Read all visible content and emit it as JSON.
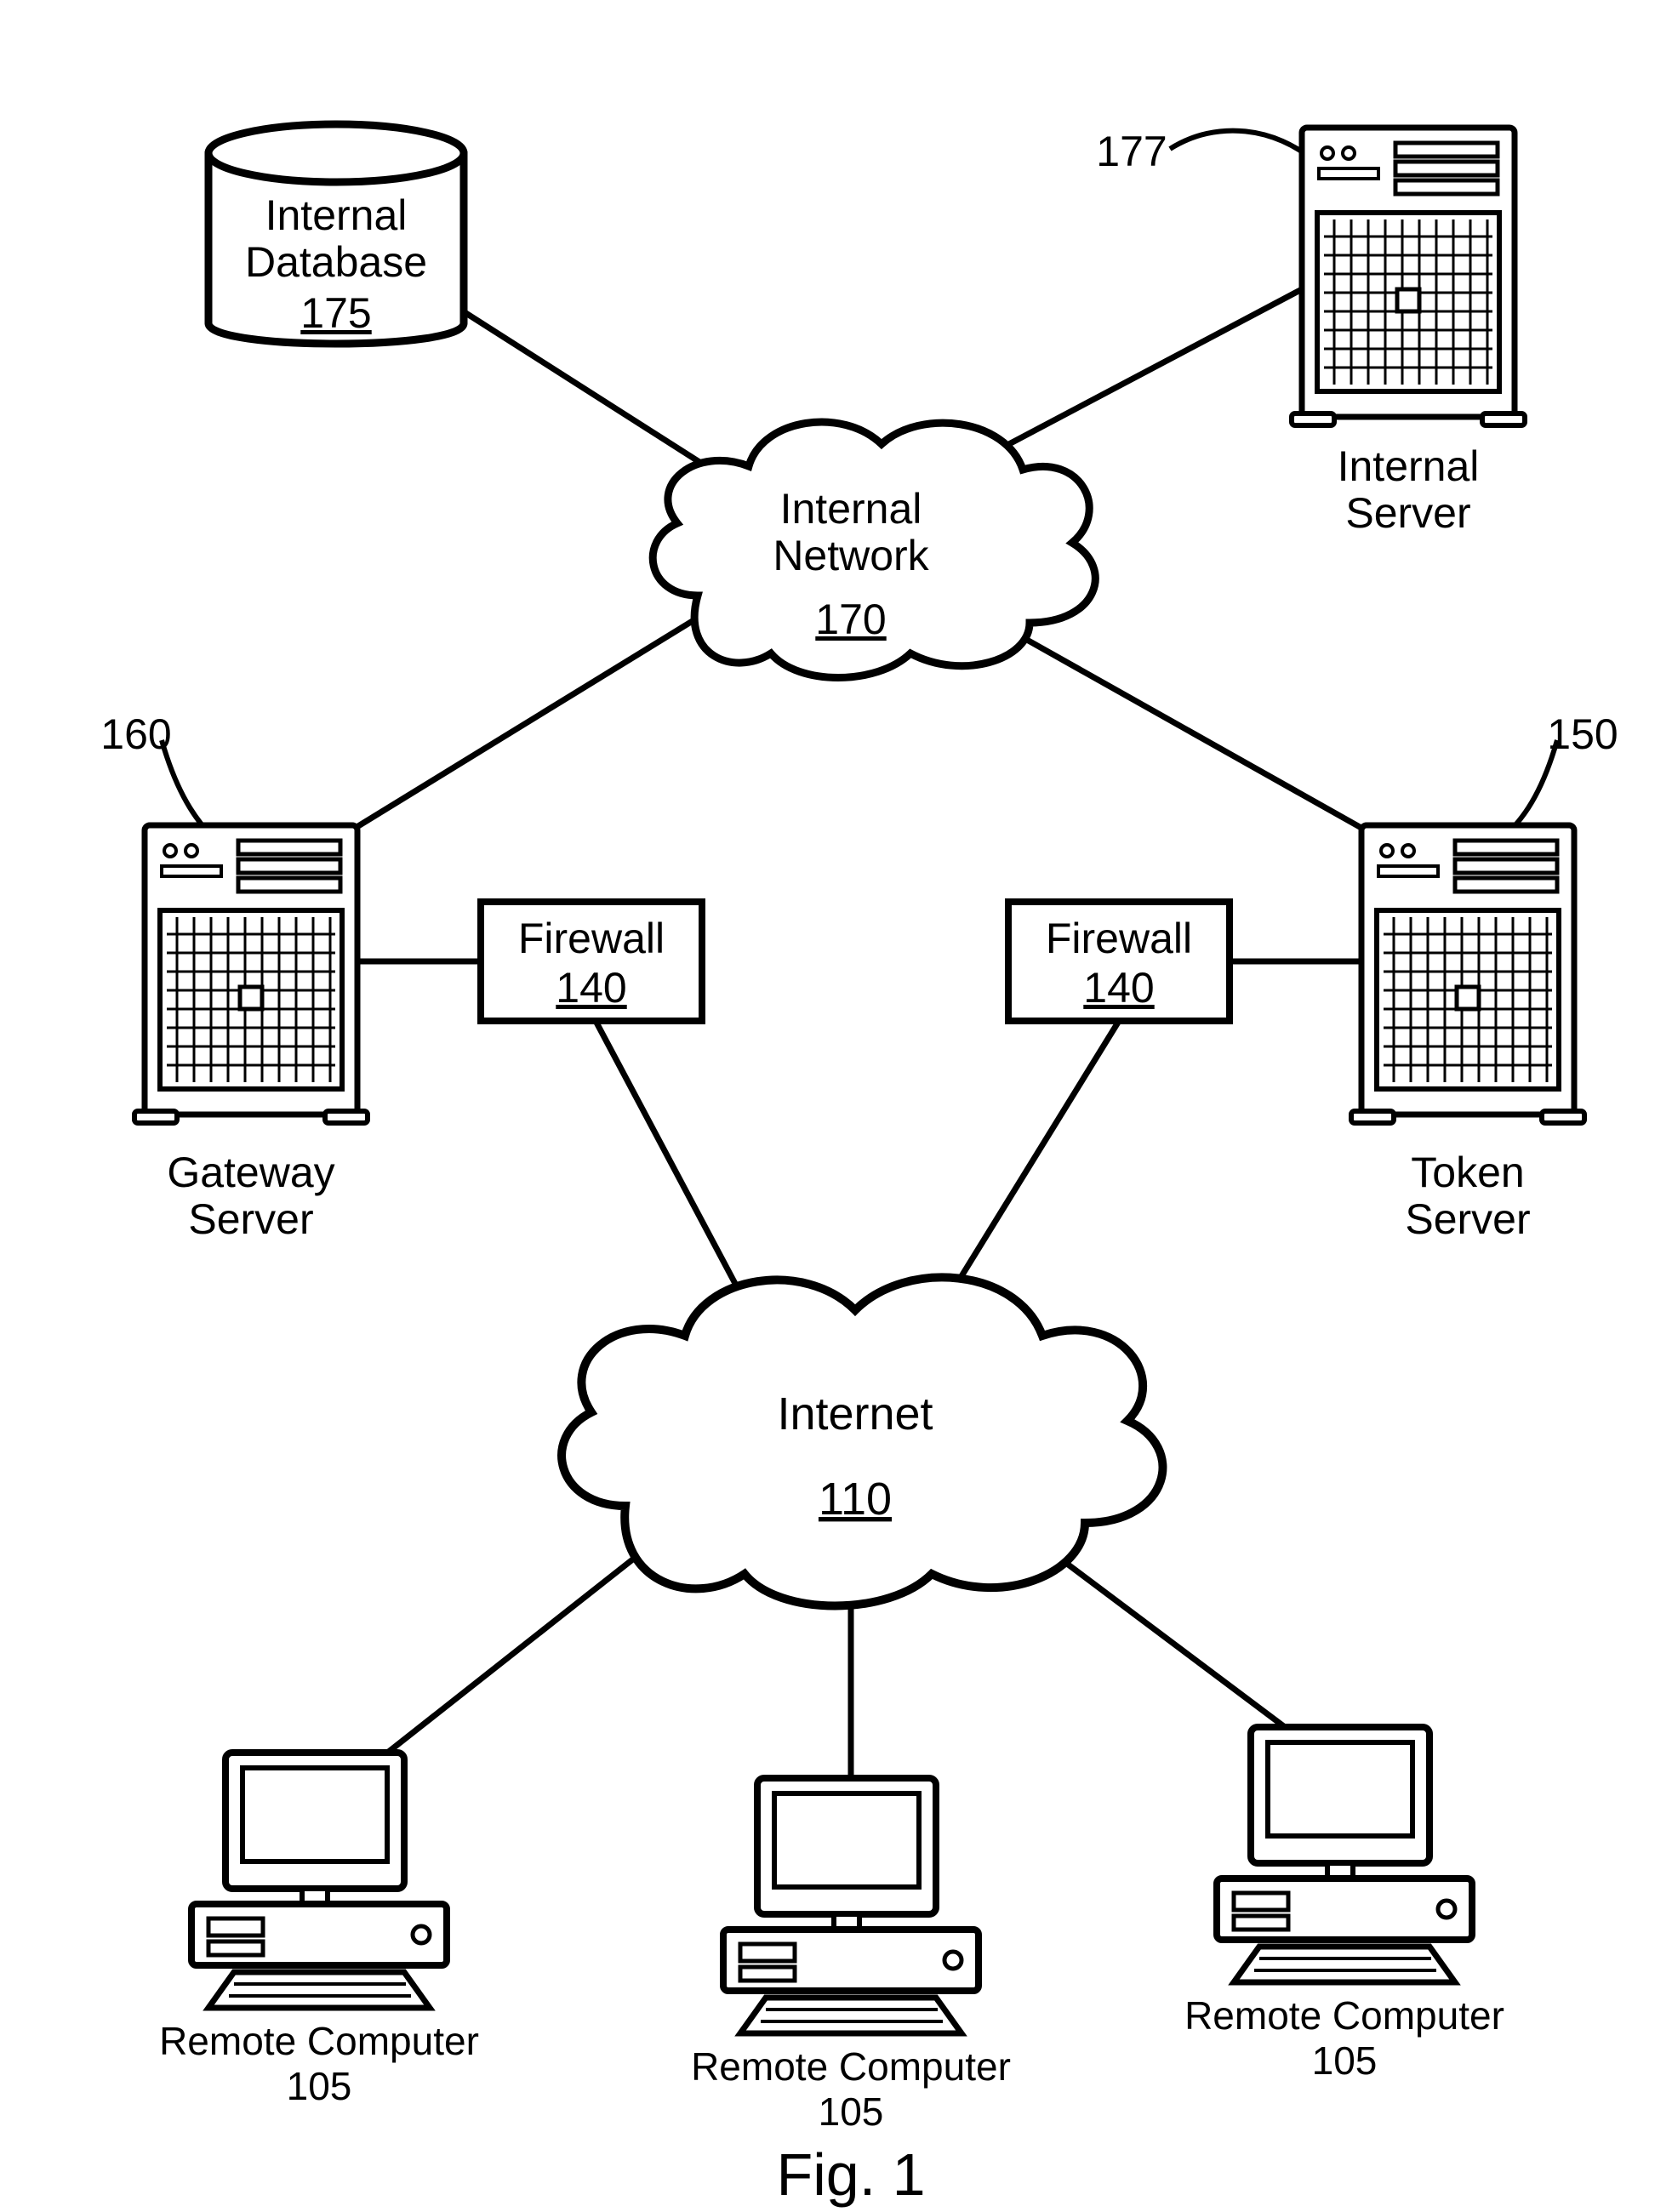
{
  "figure_label": "Fig. 1",
  "nodes": {
    "internal_database": {
      "label": "Internal\nDatabase",
      "ref": "175"
    },
    "internal_server": {
      "label": "Internal\nServer",
      "ref": "177"
    },
    "internal_network": {
      "label": "Internal\nNetwork",
      "ref": "170"
    },
    "gateway_server": {
      "label": "Gateway\nServer",
      "ref": "160"
    },
    "token_server": {
      "label": "Token\nServer",
      "ref": "150"
    },
    "firewall_left": {
      "label": "Firewall",
      "ref": "140"
    },
    "firewall_right": {
      "label": "Firewall",
      "ref": "140"
    },
    "internet": {
      "label": "Internet",
      "ref": "110"
    },
    "remote_computer_1": {
      "label": "Remote Computer",
      "ref": "105"
    },
    "remote_computer_2": {
      "label": "Remote Computer",
      "ref": "105"
    },
    "remote_computer_3": {
      "label": "Remote Computer",
      "ref": "105"
    }
  },
  "edges": [
    [
      "internal_database",
      "internal_network"
    ],
    [
      "internal_server",
      "internal_network"
    ],
    [
      "internal_network",
      "gateway_server"
    ],
    [
      "internal_network",
      "token_server"
    ],
    [
      "gateway_server",
      "firewall_left"
    ],
    [
      "token_server",
      "firewall_right"
    ],
    [
      "firewall_left",
      "internet"
    ],
    [
      "firewall_right",
      "internet"
    ],
    [
      "internet",
      "remote_computer_1"
    ],
    [
      "internet",
      "remote_computer_2"
    ],
    [
      "internet",
      "remote_computer_3"
    ]
  ]
}
